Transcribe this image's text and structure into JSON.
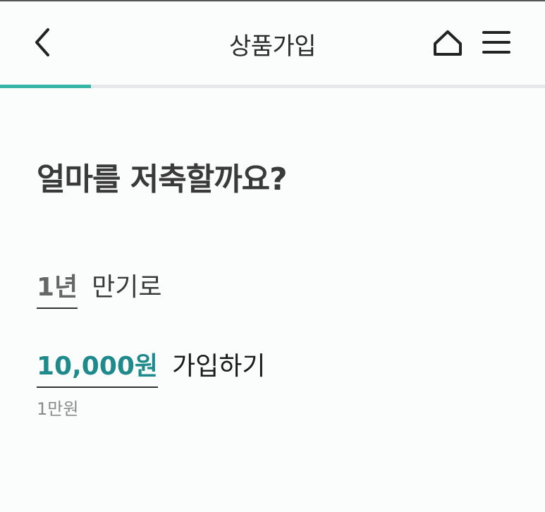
{
  "header": {
    "title": "상품가입",
    "back_icon": "chevron-left-icon",
    "home_icon": "home-icon",
    "menu_icon": "hamburger-menu-icon"
  },
  "progress": {
    "fraction": 0.167,
    "fill_color": "#39b5a8",
    "track_color": "#e6e8ec"
  },
  "main": {
    "question": "얼마를 저축할까요?",
    "period": {
      "value": "1년",
      "suffix": "만기로"
    },
    "amount": {
      "value": "10,000원",
      "suffix": "가입하기",
      "hint": "1만원",
      "accent_color": "#1e8a8c"
    }
  }
}
